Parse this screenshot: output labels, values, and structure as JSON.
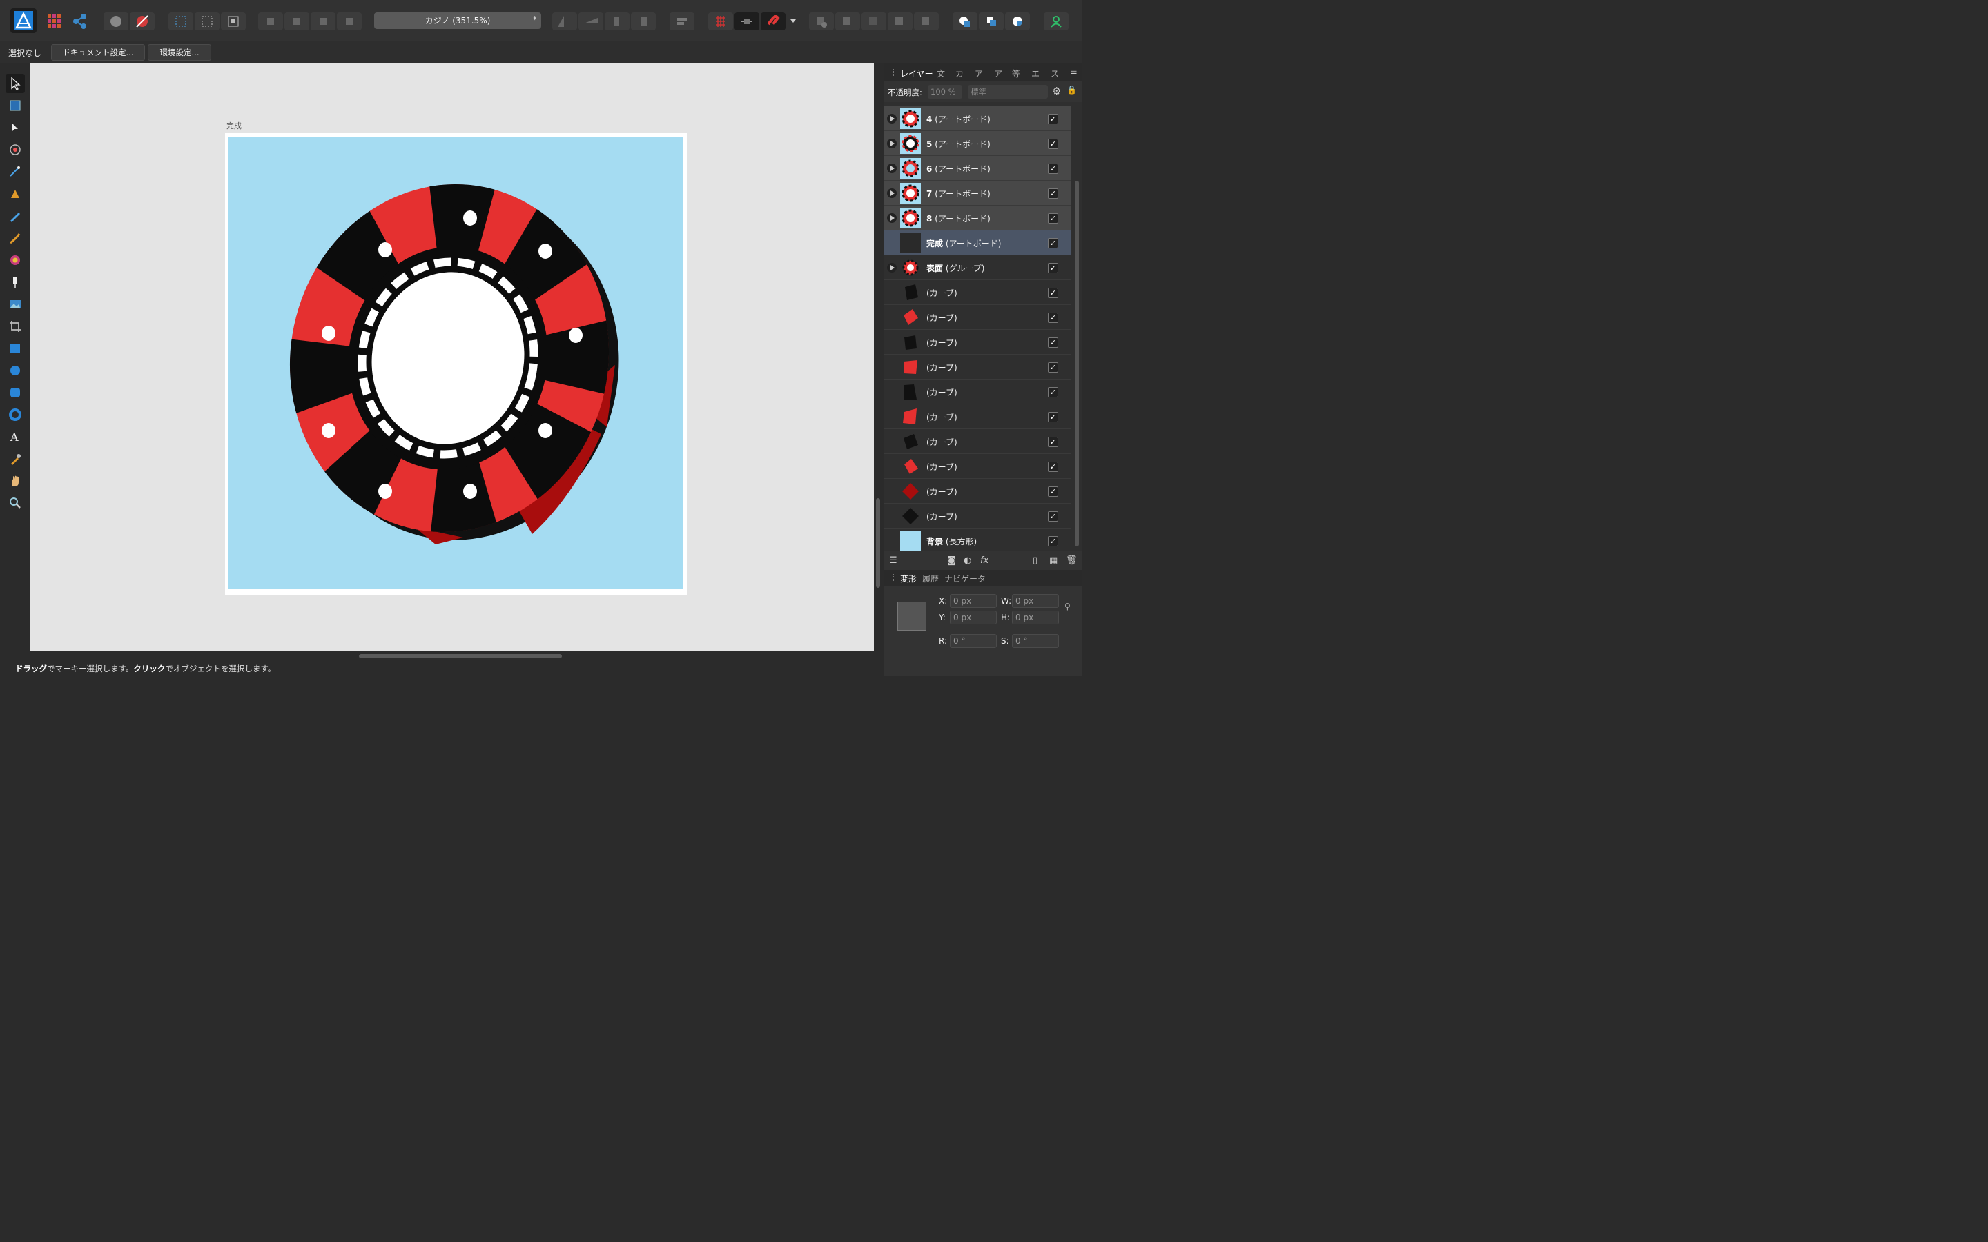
{
  "toolbar": {
    "doc_title": "カジノ (351.5%)",
    "modified_mark": "*"
  },
  "context": {
    "selection_status": "選択なし",
    "doc_settings_label": "ドキュメント設定...",
    "prefs_label": "環境設定..."
  },
  "artboard": {
    "label": "完成",
    "background_color": "#a5dcf2"
  },
  "status": {
    "drag": "ドラッグ",
    "drag_desc": "でマーキー選択します。",
    "click": "クリック",
    "click_desc": "でオブジェクトを選択します。"
  },
  "panel": {
    "tabs": [
      "レイヤー",
      "文",
      "カ",
      "ア",
      "ア",
      "等",
      "エ",
      "ス"
    ],
    "opacity_label": "不透明度:",
    "opacity_value": "100 %",
    "blend_mode": "標準",
    "layers": [
      {
        "name": "4",
        "type": "(アートボード)",
        "checked": "✓"
      },
      {
        "name": "5",
        "type": "(アートボード)",
        "checked": "✓"
      },
      {
        "name": "6",
        "type": "(アートボード)",
        "checked": "✓"
      },
      {
        "name": "7",
        "type": "(アートボード)",
        "checked": "✓"
      },
      {
        "name": "8",
        "type": "(アートボード)",
        "checked": "✓"
      },
      {
        "name": "完成",
        "type": "(アートボード)",
        "checked": "✓"
      },
      {
        "name": "表面",
        "type": "(グループ)",
        "checked": "✓"
      },
      {
        "name": "",
        "type": "(カーブ)",
        "checked": "✓"
      },
      {
        "name": "",
        "type": "(カーブ)",
        "checked": "✓"
      },
      {
        "name": "",
        "type": "(カーブ)",
        "checked": "✓"
      },
      {
        "name": "",
        "type": "(カーブ)",
        "checked": "✓"
      },
      {
        "name": "",
        "type": "(カーブ)",
        "checked": "✓"
      },
      {
        "name": "",
        "type": "(カーブ)",
        "checked": "✓"
      },
      {
        "name": "",
        "type": "(カーブ)",
        "checked": "✓"
      },
      {
        "name": "",
        "type": "(カーブ)",
        "checked": "✓"
      },
      {
        "name": "",
        "type": "(カーブ)",
        "checked": "✓"
      },
      {
        "name": "",
        "type": "(カーブ)",
        "checked": "✓"
      },
      {
        "name": "背景",
        "type": "(長方形)",
        "checked": "✓"
      }
    ],
    "tabs2": [
      "変形",
      "履歴",
      "ナビゲータ"
    ],
    "transform": {
      "x_label": "X:",
      "x": "0 px",
      "y_label": "Y:",
      "y": "0 px",
      "w_label": "W:",
      "w": "0 px",
      "h_label": "H:",
      "h": "0 px",
      "r_label": "R:",
      "r": "0 °",
      "s_label": "S:",
      "s": "0 °"
    }
  },
  "colors": {
    "chip_red": "#e53030",
    "chip_dark_red": "#a80d0d",
    "chip_black": "#0c0c0c",
    "accent_green": "#2fbf6a"
  }
}
